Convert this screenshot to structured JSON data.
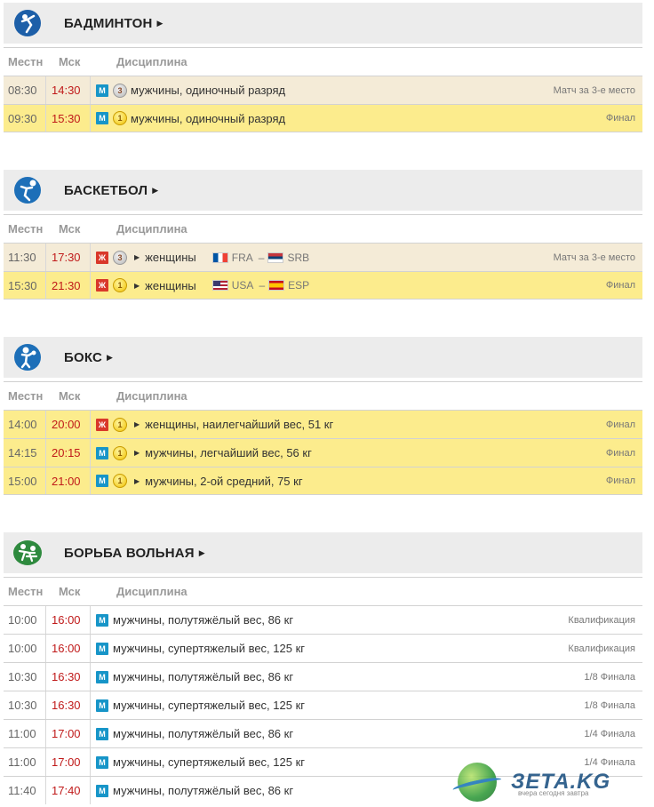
{
  "columns": {
    "local": "Местн",
    "msk": "Мск",
    "discipline": "Дисциплина"
  },
  "sports": [
    {
      "name": "БАДМИНТОН",
      "icon": "badminton-icon",
      "rows": [
        {
          "local": "08:30",
          "msk": "14:30",
          "gender": "М",
          "medal": "bronze",
          "text": "мужчины, одиночный разряд",
          "stage": "Матч за 3-е место"
        },
        {
          "local": "09:30",
          "msk": "15:30",
          "gender": "М",
          "medal": "gold",
          "text": "мужчины, одиночный разряд",
          "stage": "Финал"
        }
      ]
    },
    {
      "name": "БАСКЕТБОЛ",
      "icon": "basketball-icon",
      "rows": [
        {
          "local": "11:30",
          "msk": "17:30",
          "gender": "Ж",
          "medal": "bronze",
          "text": "женщины",
          "team1": "FRA",
          "team2": "SRB",
          "stage": "Матч за 3-е место"
        },
        {
          "local": "15:30",
          "msk": "21:30",
          "gender": "Ж",
          "medal": "gold",
          "text": "женщины",
          "team1": "USA",
          "team2": "ESP",
          "stage": "Финал"
        }
      ]
    },
    {
      "name": "БОКС",
      "icon": "boxing-icon",
      "rows": [
        {
          "local": "14:00",
          "msk": "20:00",
          "gender": "Ж",
          "medal": "gold",
          "text": "женщины, наилегчайший вес, 51 кг",
          "stage": "Финал"
        },
        {
          "local": "14:15",
          "msk": "20:15",
          "gender": "М",
          "medal": "gold",
          "text": "мужчины, легчайший вес, 56 кг",
          "stage": "Финал"
        },
        {
          "local": "15:00",
          "msk": "21:00",
          "gender": "М",
          "medal": "gold",
          "text": "мужчины, 2-ой средний, 75 кг",
          "stage": "Финал"
        }
      ]
    },
    {
      "name": "БОРЬБА ВОЛЬНАЯ",
      "icon": "wrestling-icon",
      "rows": [
        {
          "local": "10:00",
          "msk": "16:00",
          "gender": "М",
          "text": "мужчины, полутяжёлый вес, 86 кг",
          "stage": "Квалификация"
        },
        {
          "local": "10:00",
          "msk": "16:00",
          "gender": "М",
          "text": "мужчины, супертяжелый вес, 125 кг",
          "stage": "Квалификация"
        },
        {
          "local": "10:30",
          "msk": "16:30",
          "gender": "М",
          "text": "мужчины, полутяжёлый вес, 86 кг",
          "stage": "1/8 Финала"
        },
        {
          "local": "10:30",
          "msk": "16:30",
          "gender": "М",
          "text": "мужчины, супертяжелый вес, 125 кг",
          "stage": "1/8 Финала"
        },
        {
          "local": "11:00",
          "msk": "17:00",
          "gender": "М",
          "text": "мужчины, полутяжёлый вес, 86 кг",
          "stage": "1/4 Финала"
        },
        {
          "local": "11:00",
          "msk": "17:00",
          "gender": "М",
          "text": "мужчины, супертяжелый вес, 125 кг",
          "stage": "1/4 Финала"
        },
        {
          "local": "11:40",
          "msk": "17:40",
          "gender": "М",
          "text": "мужчины, полутяжёлый вес, 86 кг",
          "stage": ""
        }
      ]
    }
  ],
  "watermark": {
    "brand": "ЗЕТА.KG",
    "tagline": "вчера сегодня завтра"
  },
  "colors": {
    "header_bg": "#ececec",
    "bronze_row": "#f4ebd7",
    "gold_row": "#fcec8d",
    "men": "#1795c8",
    "women": "#d9382a",
    "time_msk": "#c01a1a"
  }
}
